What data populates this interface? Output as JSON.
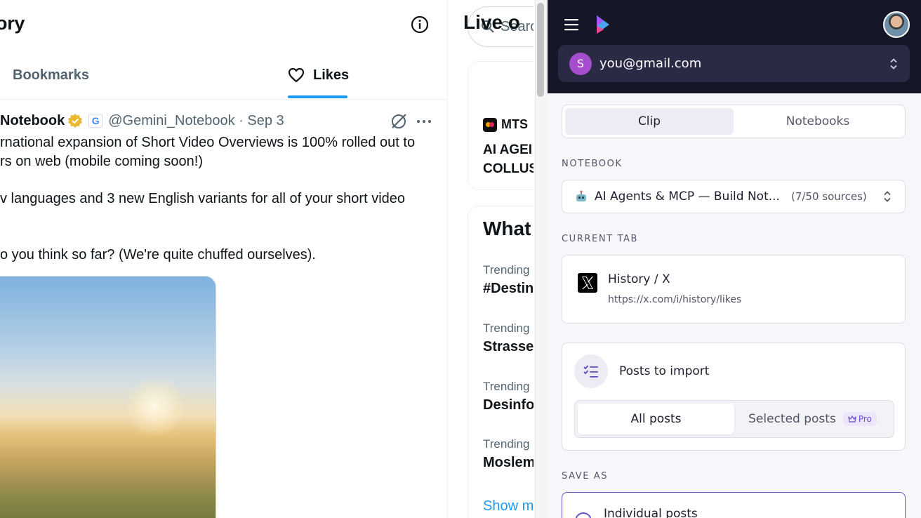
{
  "x": {
    "page_title": "ory",
    "tabs": {
      "bookmarks": "Bookmarks",
      "likes": "Likes"
    },
    "tweet": {
      "name": "Notebook",
      "handle_date": "@Gemini_Notebook · Sep 3",
      "lines": [
        "rnational expansion of Short Video Overviews is 100% rolled out to",
        "rs on web (mobile coming soon!)",
        "v languages and 3 new English variants for all of your short video",
        "o you think so far? (We're quite chuffed ourselves)."
      ]
    },
    "sidebar": {
      "search_placeholder": "Searc",
      "live_title": "Live o",
      "live_source": "MTS",
      "live_lines": [
        "AI AGEI",
        "COLLUS"
      ],
      "what_title": "What",
      "trends": [
        {
          "label": "Trending",
          "name": "#Destin"
        },
        {
          "label": "Trending",
          "name": "Strasse"
        },
        {
          "label": "Trending",
          "name": "Desinfo"
        },
        {
          "label": "Trending",
          "name": "Moslem"
        }
      ],
      "show_more": "Show m"
    }
  },
  "extension": {
    "account": {
      "initial": "S",
      "email": "you@gmail.com"
    },
    "mode_tabs": {
      "clip": "Clip",
      "notebooks": "Notebooks"
    },
    "notebook_label": "NOTEBOOK",
    "notebook": {
      "title": "AI Agents & MCP — Build Not...",
      "count": "(7/50 sources)"
    },
    "current_tab_label": "CURRENT TAB",
    "current_tab": {
      "title": "History / X",
      "url": "https://x.com/i/history/likes"
    },
    "import": {
      "title": "Posts to import",
      "all": "All posts",
      "selected": "Selected posts",
      "pro": "Pro"
    },
    "save_as_label": "SAVE AS",
    "save_option": "Individual posts",
    "colors": {
      "header": "#161629",
      "accent": "#6b4fc9",
      "x_blue": "#1d9bf0"
    }
  }
}
